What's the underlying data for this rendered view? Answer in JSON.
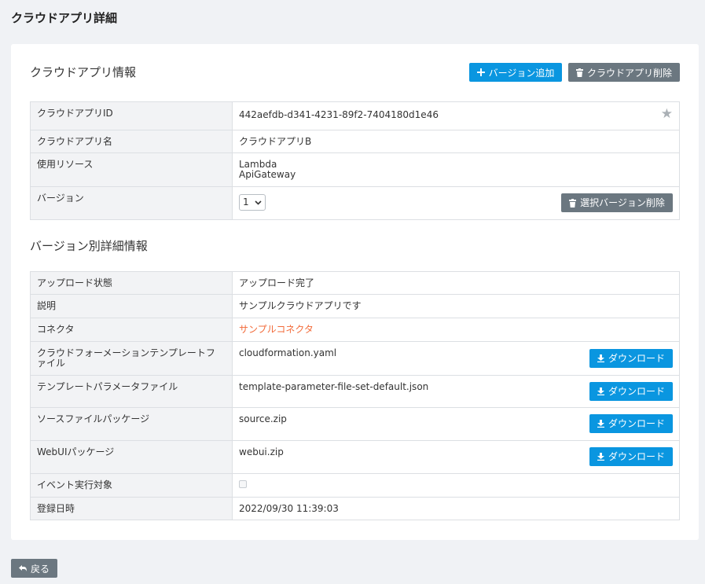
{
  "page_title": "クラウドアプリ詳細",
  "app_info": {
    "title": "クラウドアプリ情報",
    "add_version_label": "バージョン追加",
    "delete_app_label": "クラウドアプリ削除",
    "rows": {
      "id_label": "クラウドアプリID",
      "id_value": "442aefdb-d341-4231-89f2-7404180d1e46",
      "name_label": "クラウドアプリ名",
      "name_value": "クラウドアプリB",
      "resources_label": "使用リソース",
      "resources": [
        "Lambda",
        "ApiGateway"
      ],
      "version_label": "バージョン",
      "version_value": "1",
      "delete_version_label": "選択バージョン削除"
    }
  },
  "version_detail": {
    "title": "バージョン別詳細情報",
    "rows": {
      "upload_status_label": "アップロード状態",
      "upload_status_value": "アップロード完了",
      "description_label": "説明",
      "description_value": "サンプルクラウドアプリです",
      "connector_label": "コネクタ",
      "connector_value": "サンプルコネクタ",
      "cfn_label_line1": "クラウドフォーメーションテンプレートフ",
      "cfn_label_line2": "ァイル",
      "cfn_value": "cloudformation.yaml",
      "param_label": "テンプレートパラメータファイル",
      "param_value": "template-parameter-file-set-default.json",
      "source_label": "ソースファイルパッケージ",
      "source_value": "source.zip",
      "webui_label": "WebUIパッケージ",
      "webui_value": "webui.zip",
      "event_label": "イベント実行対象",
      "registered_label": "登録日時",
      "registered_value": "2022/09/30 11:39:03"
    },
    "download_label": "ダウンロード"
  },
  "back_label": "戻る",
  "colors": {
    "primary": "#0a96e0",
    "secondary": "#6b7780",
    "link": "#f26b3a"
  }
}
